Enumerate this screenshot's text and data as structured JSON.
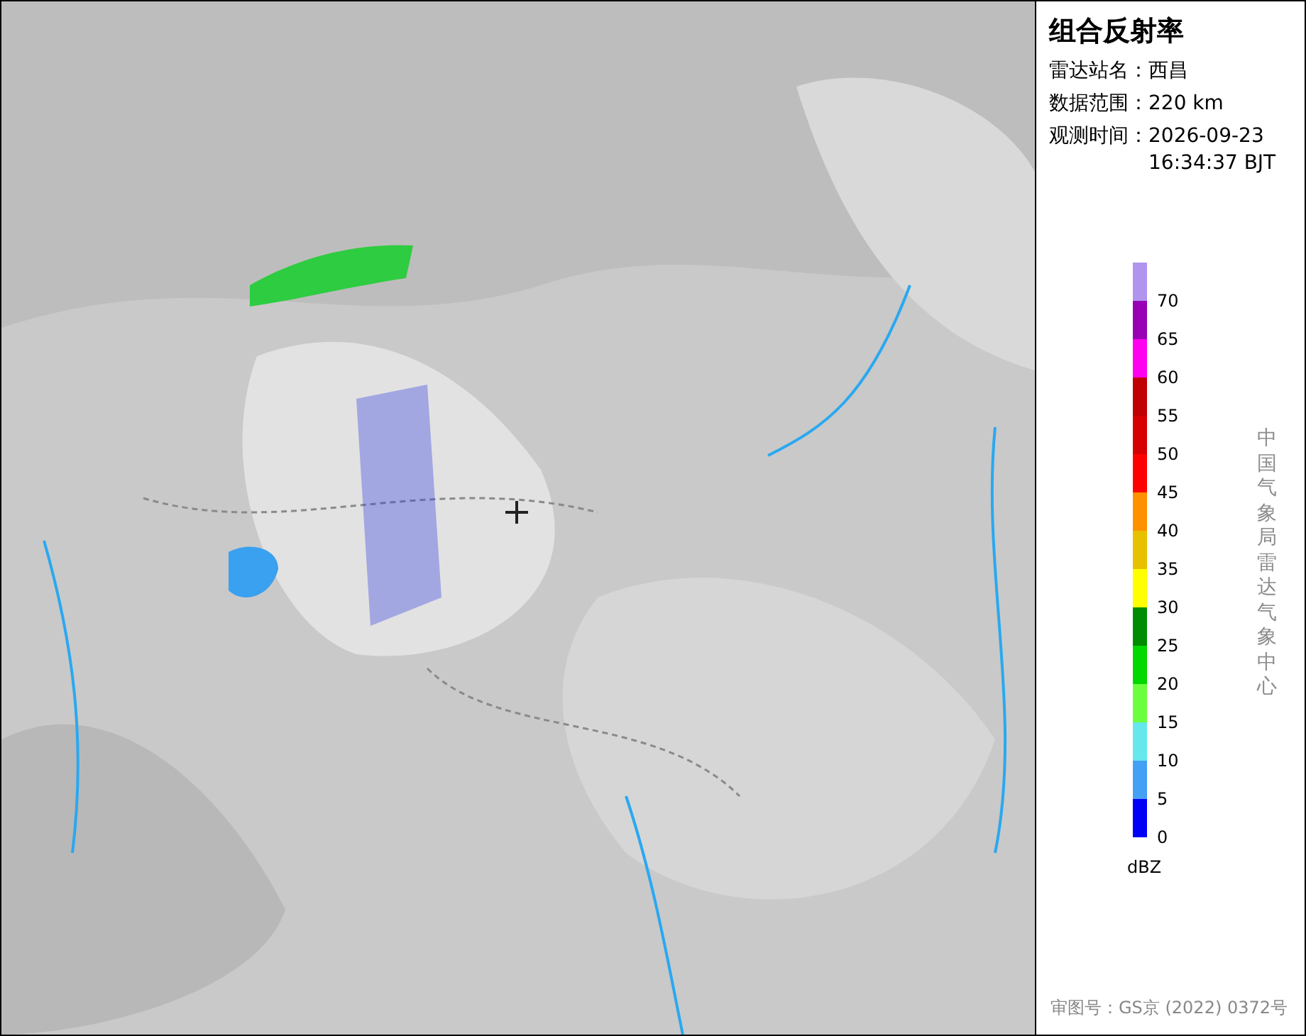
{
  "panel": {
    "title": "组合反射率",
    "fields": [
      {
        "label": "雷达站名：",
        "value": "西昌"
      },
      {
        "label": "数据范围：",
        "value": "220 km"
      },
      {
        "label": "观测时间：",
        "value": "2026-09-23 16:34:37 BJT"
      }
    ],
    "legend": {
      "unit": "dBZ",
      "bands": [
        {
          "color": "#b094ee",
          "label": "70"
        },
        {
          "color": "#9900b4",
          "label": "65"
        },
        {
          "color": "#ff00f0",
          "label": "60"
        },
        {
          "color": "#c00000",
          "label": "55"
        },
        {
          "color": "#d60000",
          "label": "50"
        },
        {
          "color": "#ff0000",
          "label": "45"
        },
        {
          "color": "#ff9000",
          "label": "40"
        },
        {
          "color": "#e7c000",
          "label": "35"
        },
        {
          "color": "#ffff00",
          "label": "30"
        },
        {
          "color": "#008c00",
          "label": "25"
        },
        {
          "color": "#00d800",
          "label": "20"
        },
        {
          "color": "#6cff40",
          "label": "15"
        },
        {
          "color": "#64e8ec",
          "label": "10"
        },
        {
          "color": "#44a0f4",
          "label": "5"
        },
        {
          "color": "#0000f6",
          "label": "0"
        }
      ]
    },
    "credit": "中国气象局雷达气象中心",
    "approval": "审图号：GS京 (2022) 0372号"
  }
}
